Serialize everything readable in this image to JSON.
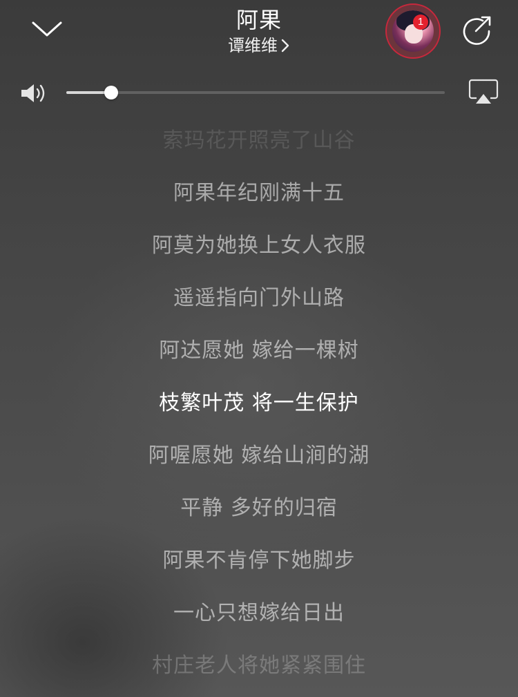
{
  "header": {
    "collapse_icon": "chevron-down-icon",
    "title": "阿果",
    "artist": "谭维维",
    "artist_icon": "chevron-right-icon",
    "avatar_badge": "1",
    "share_icon": "share-icon",
    "accent_color": "#c8283c",
    "badge_color": "#e4222f"
  },
  "volume": {
    "speaker_icon": "speaker-icon",
    "level": 0.118,
    "airplay_icon": "airplay-icon"
  },
  "lyrics": {
    "lines": [
      "索玛花开照亮了山谷",
      "阿果年纪刚满十五",
      "阿莫为她换上女人衣服",
      "遥遥指向门外山路",
      "阿达愿她 嫁给一棵树",
      "枝繁叶茂 将一生保护",
      "阿喔愿她 嫁给山涧的湖",
      "平静 多好的归宿",
      "阿果不肯停下她脚步",
      "一心只想嫁给日出",
      "村庄老人将她紧紧围住"
    ],
    "active_index": 5
  }
}
